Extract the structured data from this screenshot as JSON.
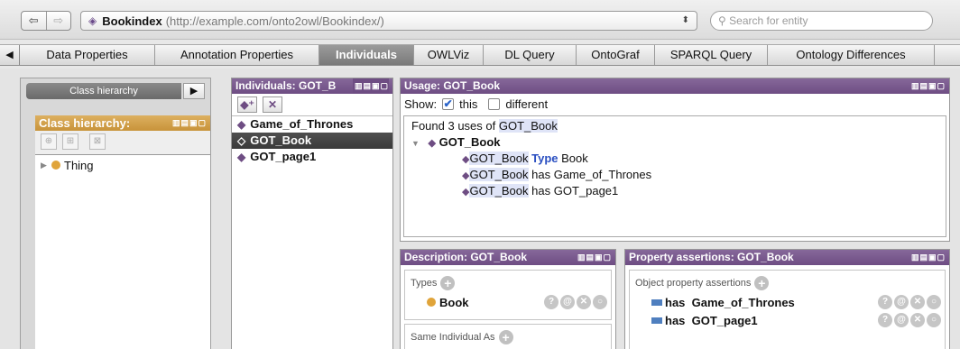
{
  "toolbar": {
    "back_icon": "⇦",
    "forward_icon": "⇨",
    "ontology_name": "Bookindex",
    "ontology_iri": "(http://example.com/onto2owl/Bookindex/)",
    "search_placeholder": "Search for entity"
  },
  "tabs": [
    {
      "label": "Data Properties",
      "active": false
    },
    {
      "label": "Annotation Properties",
      "active": false
    },
    {
      "label": "Individuals",
      "active": true
    },
    {
      "label": "OWLViz",
      "active": false
    },
    {
      "label": "DL Query",
      "active": false
    },
    {
      "label": "OntoGraf",
      "active": false
    },
    {
      "label": "SPARQL Query",
      "active": false
    },
    {
      "label": "Ontology Differences",
      "active": false
    }
  ],
  "class_panel": {
    "tab_label": "Class hierarchy",
    "header": "Class hierarchy:",
    "tree": [
      {
        "label": "Thing"
      }
    ]
  },
  "individuals": {
    "header": "Individuals: GOT_B",
    "items": [
      {
        "label": "Game_of_Thrones",
        "selected": false
      },
      {
        "label": "GOT_Book",
        "selected": true
      },
      {
        "label": "GOT_page1",
        "selected": false
      }
    ]
  },
  "usage": {
    "header": "Usage: GOT_Book",
    "show_label": "Show:",
    "this_label": "this",
    "this_checked": true,
    "different_label": "different",
    "different_checked": false,
    "found_text": "Found 3 uses of",
    "found_entity": "GOT_Book",
    "root": "GOT_Book",
    "uses": [
      {
        "subject": "GOT_Book",
        "predicate": "Type",
        "object": "Book",
        "keyword": true
      },
      {
        "subject": "GOT_Book",
        "predicate": "has",
        "object": "Game_of_Thrones",
        "keyword": false
      },
      {
        "subject": "GOT_Book",
        "predicate": "has",
        "object": "GOT_page1",
        "keyword": false
      }
    ]
  },
  "description": {
    "header": "Description: GOT_Book",
    "types_label": "Types",
    "types": [
      "Book"
    ],
    "same_label": "Same Individual As"
  },
  "property_assertions": {
    "header": "Property assertions: GOT_Book",
    "object_label": "Object property assertions",
    "assertions": [
      {
        "property": "has",
        "value": "Game_of_Thrones"
      },
      {
        "property": "has",
        "value": "GOT_page1"
      }
    ]
  },
  "colors": {
    "view_header": "#6e4d83",
    "class_header": "#c8933a",
    "keyword": "#2a4fc1",
    "object_property": "#4f7fbf"
  }
}
